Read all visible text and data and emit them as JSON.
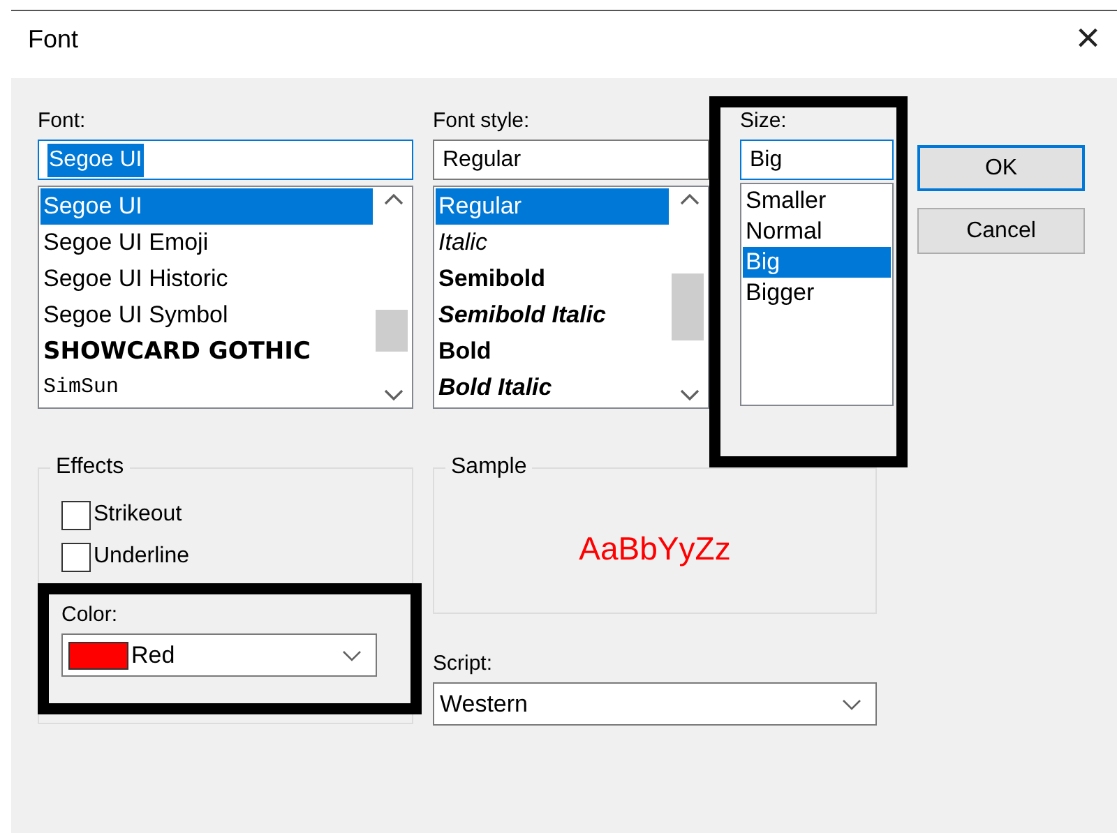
{
  "window": {
    "title": "Font",
    "close": "×"
  },
  "font": {
    "label": "Font:",
    "value": "Segoe UI",
    "value_selected": true,
    "items": [
      {
        "label": "Segoe UI",
        "kind": "sans",
        "selected": true
      },
      {
        "label": "Segoe UI Emoji",
        "kind": "sans",
        "selected": false
      },
      {
        "label": "Segoe UI Historic",
        "kind": "sans",
        "selected": false
      },
      {
        "label": "Segoe UI Symbol",
        "kind": "sans",
        "selected": false
      },
      {
        "label": "SHOWCARD GOTHIC",
        "kind": "display",
        "selected": false
      },
      {
        "label": "SimSun",
        "kind": "serif",
        "selected": false
      }
    ]
  },
  "font_style": {
    "label": "Font style:",
    "value": "Regular",
    "items": [
      {
        "label": "Regular",
        "kind": "regular",
        "selected": true
      },
      {
        "label": "Italic",
        "kind": "italic",
        "selected": false
      },
      {
        "label": "Semibold",
        "kind": "semibold",
        "selected": false
      },
      {
        "label": "Semibold Italic",
        "kind": "semibold-italic",
        "selected": false
      },
      {
        "label": "Bold",
        "kind": "bold",
        "selected": false
      },
      {
        "label": "Bold Italic",
        "kind": "bold-italic",
        "selected": false
      }
    ]
  },
  "size": {
    "label": "Size:",
    "value": "Big",
    "items": [
      {
        "label": "Smaller",
        "selected": false
      },
      {
        "label": "Normal",
        "selected": false
      },
      {
        "label": "Big",
        "selected": true
      },
      {
        "label": "Bigger",
        "selected": false
      }
    ]
  },
  "buttons": [
    {
      "label": "OK",
      "default": true
    },
    {
      "label": "Cancel",
      "default": false
    }
  ],
  "effects": {
    "title": "Effects",
    "options": [
      {
        "label": "Strikeout",
        "checked": false
      },
      {
        "label": "Underline",
        "checked": false
      }
    ]
  },
  "color": {
    "label": "Color:",
    "value": "Red",
    "color": "#ff0000"
  },
  "sample": {
    "title": "Sample",
    "text": "AaBbYyZz"
  },
  "script": {
    "label": "Script:",
    "value": "Western"
  }
}
